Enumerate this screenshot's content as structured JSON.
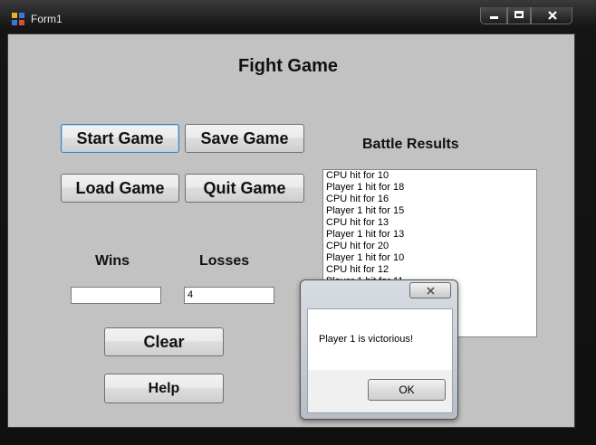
{
  "window": {
    "title": "Form1",
    "icons": {
      "app": "form-icon",
      "minimize": "minimize-icon",
      "maximize": "maximize-icon",
      "close": "close-icon"
    }
  },
  "form": {
    "heading": "Fight Game",
    "buttons": {
      "start": "Start Game",
      "save": "Save Game",
      "load": "Load Game",
      "quit": "Quit Game",
      "clear": "Clear",
      "help": "Help"
    },
    "wins_label": "Wins",
    "losses_label": "Losses",
    "wins_value": "",
    "losses_value": "4",
    "results_label": "Battle Results",
    "results": [
      "CPU hit for 10",
      "Player 1 hit for 18",
      "CPU hit for 16",
      "Player 1 hit for 15",
      "CPU hit for 13",
      "Player 1 hit for 13",
      "CPU hit for 20",
      "Player 1 hit for 10",
      "CPU hit for 12",
      "Player 1 hit for 11"
    ]
  },
  "dialog": {
    "message": "Player 1 is victorious!",
    "ok_label": "OK"
  }
}
